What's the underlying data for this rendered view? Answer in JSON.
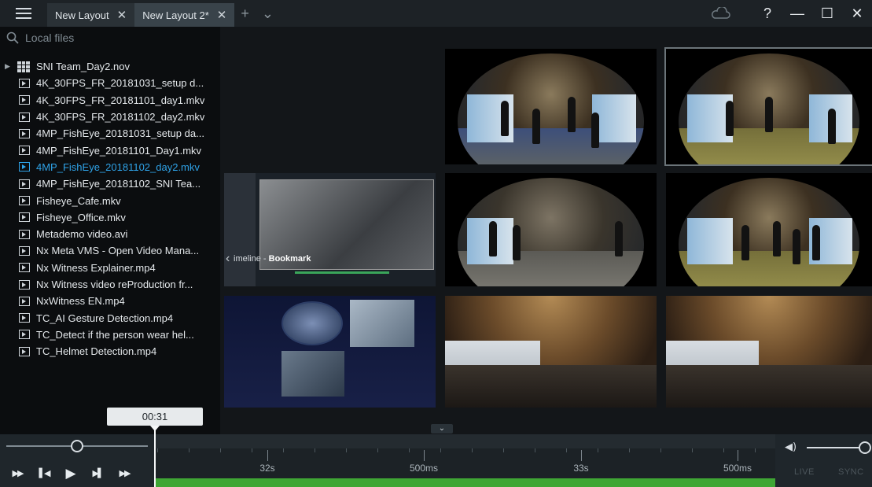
{
  "titlebar": {
    "tabs": [
      {
        "label": "New Layout",
        "active": false
      },
      {
        "label": "New Layout 2*",
        "active": true
      }
    ],
    "add_tab": "+",
    "more_tabs": "⌄",
    "help": "?",
    "minimize": "—",
    "maximize": "☐",
    "close": "✕",
    "cloud_icon": "cloud-icon"
  },
  "sidebar": {
    "search_placeholder": "Local files",
    "items": [
      {
        "label": "SNI Team_Day2.nov",
        "type": "layout"
      },
      {
        "label": "4K_30FPS_FR_20181031_setup d...",
        "type": "video"
      },
      {
        "label": "4K_30FPS_FR_20181101_day1.mkv",
        "type": "video"
      },
      {
        "label": "4K_30FPS_FR_20181102_day2.mkv",
        "type": "video"
      },
      {
        "label": "4MP_FishEye_20181031_setup da...",
        "type": "video"
      },
      {
        "label": "4MP_FishEye_20181101_Day1.mkv",
        "type": "video"
      },
      {
        "label": "4MP_FishEye_20181102_day2.mkv",
        "type": "video",
        "selected": true
      },
      {
        "label": "4MP_FishEye_20181102_SNI Tea...",
        "type": "video"
      },
      {
        "label": "Fisheye_Cafe.mkv",
        "type": "video"
      },
      {
        "label": "Fisheye_Office.mkv",
        "type": "video"
      },
      {
        "label": "Metademo video.avi",
        "type": "video"
      },
      {
        "label": "Nx Meta VMS - Open Video Mana...",
        "type": "video"
      },
      {
        "label": "Nx Witness Explainer.mp4",
        "type": "video"
      },
      {
        "label": "Nx Witness video reProduction fr...",
        "type": "video"
      },
      {
        "label": "NxWitness EN.mp4",
        "type": "video"
      },
      {
        "label": "TC_AI Gesture Detection.mp4",
        "type": "video"
      },
      {
        "label": "TC_Detect if the person wear hel...",
        "type": "video"
      },
      {
        "label": "TC_Helmet Detection.mp4",
        "type": "video"
      }
    ]
  },
  "viewport": {
    "screen_tile_text": {
      "timeline": "imeline",
      "bookmark": "Bookmark"
    }
  },
  "playback": {
    "current_time": "00:31",
    "tick_labels": [
      "32s",
      "500ms",
      "33s",
      "500ms"
    ],
    "live": "LIVE",
    "sync": "SYNC",
    "volume_icon": "volume-icon"
  }
}
